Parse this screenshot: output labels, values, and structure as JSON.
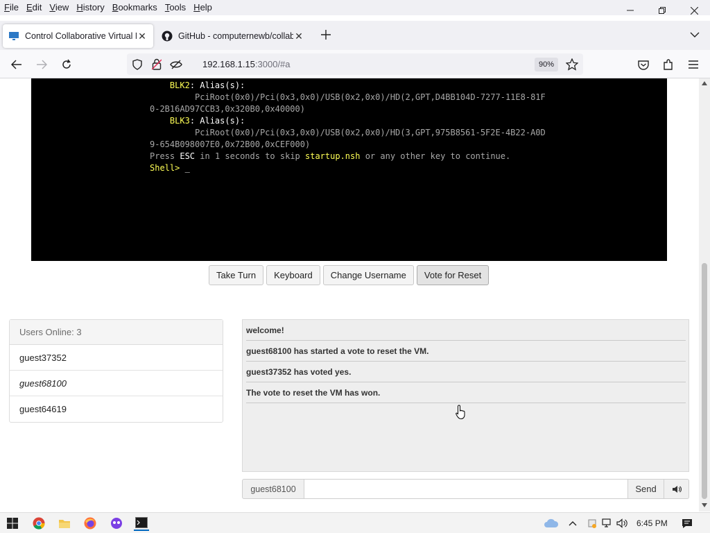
{
  "menu": {
    "items": [
      {
        "accel": "F",
        "rest": "ile"
      },
      {
        "accel": "E",
        "rest": "dit"
      },
      {
        "accel": "V",
        "rest": "iew"
      },
      {
        "accel": "H",
        "rest": "istory"
      },
      {
        "accel": "B",
        "rest": "ookmarks"
      },
      {
        "accel": "T",
        "rest": "ools"
      },
      {
        "accel": "H",
        "rest": "elp"
      }
    ]
  },
  "tabs": [
    {
      "title": "Control Collaborative Virtual M",
      "active": true
    },
    {
      "title": "GitHub - computernewb/collab",
      "active": false
    }
  ],
  "address": {
    "host": "192.168.1.15",
    "rest": ":3000/#a",
    "zoom": "90%"
  },
  "console": {
    "lines": [
      [
        {
          "t": "    ",
          "c": ""
        },
        {
          "t": "BLK2",
          "c": "y"
        },
        {
          "t": ": Alias(s):",
          "c": "w"
        }
      ],
      [
        {
          "t": "         PciRoot(0x0)/Pci(0x3,0x0)/USB(0x2,0x0)/HD(2,GPT,D4BB104D-7277-11E8-81F",
          "c": ""
        }
      ],
      [
        {
          "t": "0-2B16AD97CCB3,0x320B0,0x40000)",
          "c": ""
        }
      ],
      [
        {
          "t": "    ",
          "c": ""
        },
        {
          "t": "BLK3",
          "c": "y"
        },
        {
          "t": ": Alias(s):",
          "c": "w"
        }
      ],
      [
        {
          "t": "         PciRoot(0x0)/Pci(0x3,0x0)/USB(0x2,0x0)/HD(3,GPT,975B8561-5F2E-4B22-A0D",
          "c": ""
        }
      ],
      [
        {
          "t": "9-654B098007E0,0x72B00,0xCEF000)",
          "c": ""
        }
      ],
      [
        {
          "t": "Press ",
          "c": ""
        },
        {
          "t": "ESC",
          "c": "w"
        },
        {
          "t": " in 1 seconds to skip ",
          "c": ""
        },
        {
          "t": "startup.nsh",
          "c": "y"
        },
        {
          "t": " or any other key to continue.",
          "c": ""
        }
      ],
      [
        {
          "t": "Shell> ",
          "c": "y"
        },
        {
          "t": "_",
          "c": "w"
        }
      ]
    ]
  },
  "vm_buttons": {
    "take_turn": "Take Turn",
    "keyboard": "Keyboard",
    "change_username": "Change Username",
    "vote_reset": "Vote for Reset"
  },
  "users": {
    "header": "Users Online: 3",
    "list": [
      "guest37352",
      "guest68100",
      "guest64619"
    ]
  },
  "chat": {
    "messages": [
      "welcome!",
      "guest68100 has started a vote to reset the VM.",
      "guest37352 has voted yes.",
      "The vote to reset the VM has won."
    ],
    "username": "guest68100",
    "input_value": "",
    "send_label": "Send"
  },
  "taskbar": {
    "clock": "6:45 PM"
  },
  "colors": {
    "accent": "#0060df",
    "console_yellow": "#ffff55"
  }
}
